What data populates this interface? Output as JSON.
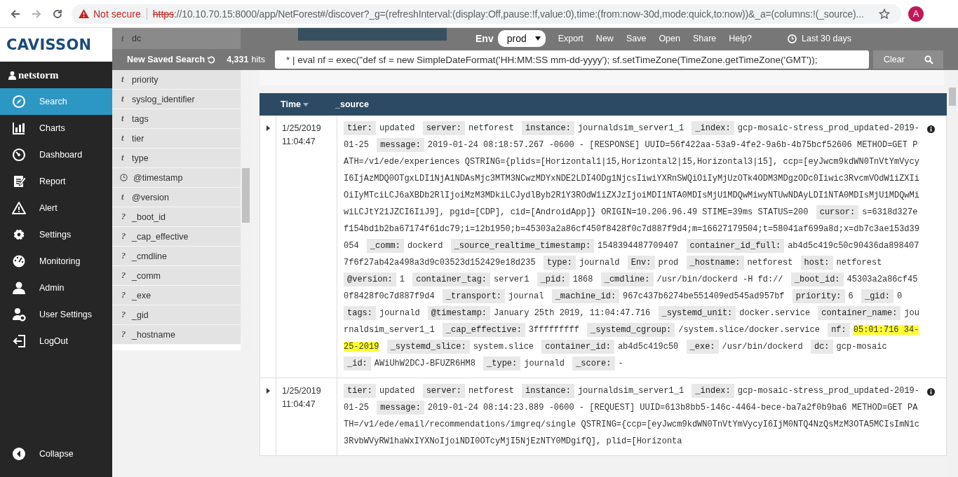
{
  "browser": {
    "security": "Not secure",
    "url_scheme": "https",
    "url_rest": "://10.10.70.15:8000/app/NetForest#/discover?_g=(refreshInterval:(display:Off,pause:!f,value:0),time:(from:now-30d,mode:quick,to:now))&_a=(columns:!(_source)...",
    "avatar": "A"
  },
  "sidebar": {
    "logo": "CAVISSON",
    "user": "netstorm",
    "items": [
      {
        "label": "Search",
        "selected": true
      },
      {
        "label": "Charts",
        "selected": false
      },
      {
        "label": "Dashboard",
        "selected": false
      },
      {
        "label": "Report",
        "selected": false
      },
      {
        "label": "Alert",
        "selected": false
      },
      {
        "label": "Settings",
        "selected": false
      },
      {
        "label": "Monitoring",
        "selected": false
      },
      {
        "label": "Admin",
        "selected": false
      },
      {
        "label": "User Settings",
        "selected": false
      },
      {
        "label": "LogOut",
        "selected": false
      }
    ],
    "collapse": "Collapse"
  },
  "toolbar": {
    "env_label": "Env",
    "env_value": "prod",
    "actions": [
      "Export",
      "New",
      "Save",
      "Open",
      "Share",
      "Help?"
    ],
    "time_range": "Last 30 days",
    "saved_search": "New Saved Search",
    "hits": "4,331",
    "hits_label": "hits",
    "query": "* | eval nf = exec(\"def sf = new SimpleDateFormat('HH:MM:SS mm-dd-yyyy'); sf.setTimeZone(TimeZone.getTimeZone('GMT'));",
    "clear": "Clear"
  },
  "fields": [
    {
      "kind": "glyph",
      "glyph": "t",
      "name": "dc"
    },
    {
      "kind": "glyph",
      "glyph": "t",
      "name": "priority"
    },
    {
      "kind": "glyph",
      "glyph": "t",
      "name": "syslog_identifier"
    },
    {
      "kind": "glyph",
      "glyph": "t",
      "name": "tags"
    },
    {
      "kind": "glyph",
      "glyph": "t",
      "name": "tier"
    },
    {
      "kind": "glyph",
      "glyph": "t",
      "name": "type"
    },
    {
      "kind": "time",
      "name": "@timestamp"
    },
    {
      "kind": "glyph",
      "glyph": "t",
      "name": "@version"
    },
    {
      "kind": "glyph",
      "glyph": "?",
      "name": "_boot_id"
    },
    {
      "kind": "glyph",
      "glyph": "?",
      "name": "_cap_effective"
    },
    {
      "kind": "glyph",
      "glyph": "?",
      "name": "_cmdline"
    },
    {
      "kind": "glyph",
      "glyph": "?",
      "name": "_comm"
    },
    {
      "kind": "glyph",
      "glyph": "?",
      "name": "_exe"
    },
    {
      "kind": "glyph",
      "glyph": "?",
      "name": "_gid"
    },
    {
      "kind": "glyph",
      "glyph": "?",
      "name": "_hostname"
    }
  ],
  "table": {
    "columns": [
      "Time",
      "_source"
    ],
    "rows": [
      {
        "expanded": false,
        "date": "1/25/2019",
        "time": "11:04:47",
        "fields": [
          {
            "key": "tier:",
            "value": "updated",
            "highlighted": false
          },
          {
            "key": "server:",
            "value": "netforest",
            "highlighted": false
          },
          {
            "key": "instance:",
            "value": "journaldsim_server1_1",
            "highlighted": false
          },
          {
            "key": "_index:",
            "value": "gcp-mosaic-stress_prod_updated-2019-01-25",
            "highlighted": false
          },
          {
            "key": "message:",
            "value": "2019-01-24 08:18:57.267 -0600 - [RESPONSE] UUID=56f422aa-53a9-4fe2-9a6b-4b75bcf52606 METHOD=GET PATH=/v1/ede/experiences QSTRING={plids=[Horizontal1|15,Horizontal2|15,Horizontal3|15], ccp=[eyJwcm9kdWN0TnVtYmVycyI6IjAzMDQ0OTgxLDI1NjA1NDAsMjc3MTM3NCwzMDYxNDE2LDI4ODg1NjcsIiwiYXRnSWQiOiIyMjUzOTk4ODM3MDgzODc0Iiwic3RvcmVOdW1iZXIiOiIyMTciLCJ6aXBDb2RlIjoiMzM3MDkiLCJydlByb2R1Y3ROdW1iZXJzIjoiMDI1NTA0MDIsMjU1MDQwMiwyNTUwNDAyLDI1NTA0MDIsMjU1MDQwMiwiLCJtY21JZCI6IiJ9], pgid=[CDP], cid=[AndroidApp]} ORIGIN=10.206.96.49 STIME=39ms STATUS=200",
            "highlighted": false
          },
          {
            "key": "cursor:",
            "value": "s=6318d327ef154bd1b2ba67174f61dc79;i=12b1950;b=45303a2a86cf450f8428f0c7d887f9d4;m=16627179504;t=58041af699a8d;x=db7c3ae153d39054",
            "highlighted": false
          },
          {
            "key": "_comm:",
            "value": "dockerd",
            "highlighted": false
          },
          {
            "key": "_source_realtime_timestamp:",
            "value": "1548394487709407",
            "highlighted": false
          },
          {
            "key": "container_id_full:",
            "value": "ab4d5c419c50c90436da8984077f6f27ab42a498a3d9c03523d152429e18d235",
            "highlighted": false
          },
          {
            "key": "type:",
            "value": "journald",
            "highlighted": false
          },
          {
            "key": "Env:",
            "value": "prod",
            "highlighted": false
          },
          {
            "key": "_hostname:",
            "value": "netforest",
            "highlighted": false
          },
          {
            "key": "host:",
            "value": "netforest",
            "highlighted": false
          },
          {
            "key": "@version:",
            "value": "1",
            "highlighted": false
          },
          {
            "key": "container_tag:",
            "value": "server1",
            "highlighted": false
          },
          {
            "key": "_pid:",
            "value": "1868",
            "highlighted": false
          },
          {
            "key": "_cmdline:",
            "value": "/usr/bin/dockerd -H fd://",
            "highlighted": false
          },
          {
            "key": "_boot_id:",
            "value": "45303a2a86cf450f8428f0c7d887f9d4",
            "highlighted": false
          },
          {
            "key": "_transport:",
            "value": "journal",
            "highlighted": false
          },
          {
            "key": "_machine_id:",
            "value": "967c437b6274be551409ed545ad957bf",
            "highlighted": false
          },
          {
            "key": "priority:",
            "value": "6",
            "highlighted": false
          },
          {
            "key": "_gid:",
            "value": "0",
            "highlighted": false
          },
          {
            "key": "tags:",
            "value": "journald",
            "highlighted": false
          },
          {
            "key": "@timestamp:",
            "value": "January 25th 2019, 11:04:47.716",
            "highlighted": false
          },
          {
            "key": "_systemd_unit:",
            "value": "docker.service",
            "highlighted": false
          },
          {
            "key": "container_name:",
            "value": "journaldsim_server1_1",
            "highlighted": false
          },
          {
            "key": "_cap_effective:",
            "value": "3fffffffff",
            "highlighted": false
          },
          {
            "key": "_systemd_cgroup:",
            "value": "/system.slice/docker.service",
            "highlighted": false
          },
          {
            "key": "nf:",
            "value": "05:01:716 34-25-2019",
            "highlighted": true
          },
          {
            "key": "_systemd_slice:",
            "value": "system.slice",
            "highlighted": false
          },
          {
            "key": "container_id:",
            "value": "ab4d5c419c50",
            "highlighted": false
          },
          {
            "key": "_exe:",
            "value": "/usr/bin/dockerd",
            "highlighted": false
          },
          {
            "key": "dc:",
            "value": "gcp-mosaic",
            "highlighted": false
          },
          {
            "key": "_id:",
            "value": "AWiUhW2DCJ-BFUZR6HM8",
            "highlighted": false
          },
          {
            "key": "_type:",
            "value": "journald",
            "highlighted": false
          },
          {
            "key": "_score:",
            "value": "-",
            "highlighted": false
          }
        ]
      },
      {
        "expanded": false,
        "date": "1/25/2019",
        "time": "11:04:47",
        "fields": [
          {
            "key": "tier:",
            "value": "updated",
            "highlighted": false
          },
          {
            "key": "server:",
            "value": "netforest",
            "highlighted": false
          },
          {
            "key": "instance:",
            "value": "journaldsim_server1_1",
            "highlighted": false
          },
          {
            "key": "_index:",
            "value": "gcp-mosaic-stress_prod_updated-2019-01-25",
            "highlighted": false
          },
          {
            "key": "message:",
            "value": "2019-01-24 08:14:23.889 -0600 - [REQUEST] UUID=613b8bb5-146c-4464-bece-ba7a2f0b9ba6 METHOD=GET PATH=/v1/ede/email/recommendations/imgreq/single QSTRING={ccp=[eyJwcm9kdWN0TnVtYmVycyI6IjM0NTQ4NzQsMzM3OTA5MCIsImN1c3RvbWVyRW1haWxIYXNoIjoiNDI0OTcyMjI5NjEzNTY0MDgifQ], plid=[Horizonta",
            "highlighted": false
          }
        ]
      }
    ]
  }
}
